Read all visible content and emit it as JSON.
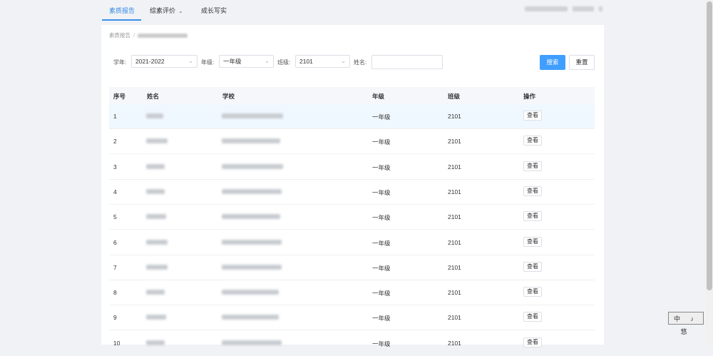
{
  "nav": {
    "tabs": [
      {
        "label": "素质报告"
      },
      {
        "label": "综素评价"
      },
      {
        "label": "成长写实"
      }
    ]
  },
  "breadcrumb": {
    "root": "素质报告",
    "sep": "/"
  },
  "filters": {
    "year_label": "学年:",
    "year_value": "2021-2022",
    "grade_label": "年级:",
    "grade_value": "一年级",
    "class_label": "班级:",
    "class_value": "2101",
    "name_label": "姓名:",
    "name_value": ""
  },
  "buttons": {
    "search": "搜索",
    "reset": "重置"
  },
  "table": {
    "headers": [
      "序号",
      "姓名",
      "学校",
      "年级",
      "班级",
      "操作"
    ],
    "rows": [
      {
        "no": "1",
        "grade": "一年级",
        "class": "2101",
        "action": "查看"
      },
      {
        "no": "2",
        "grade": "一年级",
        "class": "2101",
        "action": "查看"
      },
      {
        "no": "3",
        "grade": "一年级",
        "class": "2101",
        "action": "查看"
      },
      {
        "no": "4",
        "grade": "一年级",
        "class": "2101",
        "action": "查看"
      },
      {
        "no": "5",
        "grade": "一年级",
        "class": "2101",
        "action": "查看"
      },
      {
        "no": "6",
        "grade": "一年级",
        "class": "2101",
        "action": "查看"
      },
      {
        "no": "7",
        "grade": "一年级",
        "class": "2101",
        "action": "查看"
      },
      {
        "no": "8",
        "grade": "一年级",
        "class": "2101",
        "action": "查看"
      },
      {
        "no": "9",
        "grade": "一年级",
        "class": "2101",
        "action": "查看"
      },
      {
        "no": "10",
        "grade": "一年级",
        "class": "2101",
        "action": "查看"
      }
    ]
  },
  "watermark": "中 ♪ 悠",
  "colors": {
    "accent": "#409eff",
    "highlight_row": "#f0f8ff",
    "background": "#f0f2f5"
  },
  "icons": {
    "select_arrow": "chevron-down-icon"
  }
}
